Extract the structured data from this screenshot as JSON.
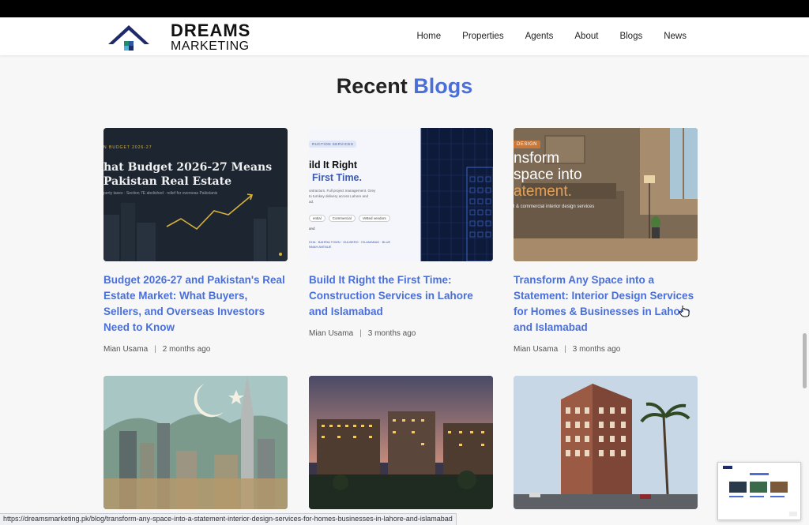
{
  "brand": {
    "name_line1": "DREAMS",
    "name_line2": "MARKETING"
  },
  "nav": [
    "Home",
    "Properties",
    "Agents",
    "About",
    "Blogs",
    "News"
  ],
  "section": {
    "title_main": "Recent",
    "title_accent": "Blogs"
  },
  "posts": [
    {
      "title": "Budget 2026-27 and Pakistan's Real Estate Market: What Buyers, Sellers, and Overseas Investors Need to Know",
      "author": "Mian Usama",
      "time": "2 months ago",
      "thumb": {
        "tag": "N BUDGET 2026-27",
        "line1": "hat Budget 2026-27 Means",
        "line2": "Pakistan Real Estate",
        "sub": "perty taxes · Section 7E abolished · relief for overseas Pakistanis"
      }
    },
    {
      "title": "Build It Right the First Time: Construction Services in Lahore and Islamabad",
      "author": "Mian Usama",
      "time": "3 months ago",
      "thumb": {
        "tag": "RUCTION SERVICES",
        "line1": "ild It Right",
        "line2": "First Time.",
        "sub": "ontractors. Full project management. Grey\nto turnkey delivery across Lahore and\nad.",
        "chips": [
          "ential",
          "Commercial",
          "Vetted vendors"
        ],
        "chip_extra": "and",
        "places": "DHA · BAHRIA TOWN · GULBERG · ISLAMABAD · BLUE\nNNAH AVENUE"
      }
    },
    {
      "title": "Transform Any Space into a Statement: Interior Design Services for Homes & Businesses in Lahore and Islamabad",
      "author": "Mian Usama",
      "time": "3 months ago",
      "thumb": {
        "tag": "DESIGN",
        "line1": "nsform",
        "line2": "space into",
        "line3": "atement.",
        "sub": "l & commercial interior design services"
      }
    }
  ],
  "status_url": "https://dreamsmarketing.pk/blog/transform-any-space-into-a-statement-interior-design-services-for-homes-businesses-in-lahore-and-islamabad",
  "colors": {
    "accent": "#4a6fd8",
    "dark_thumb": "#1d2630",
    "interior_bg": "#8a7560"
  }
}
